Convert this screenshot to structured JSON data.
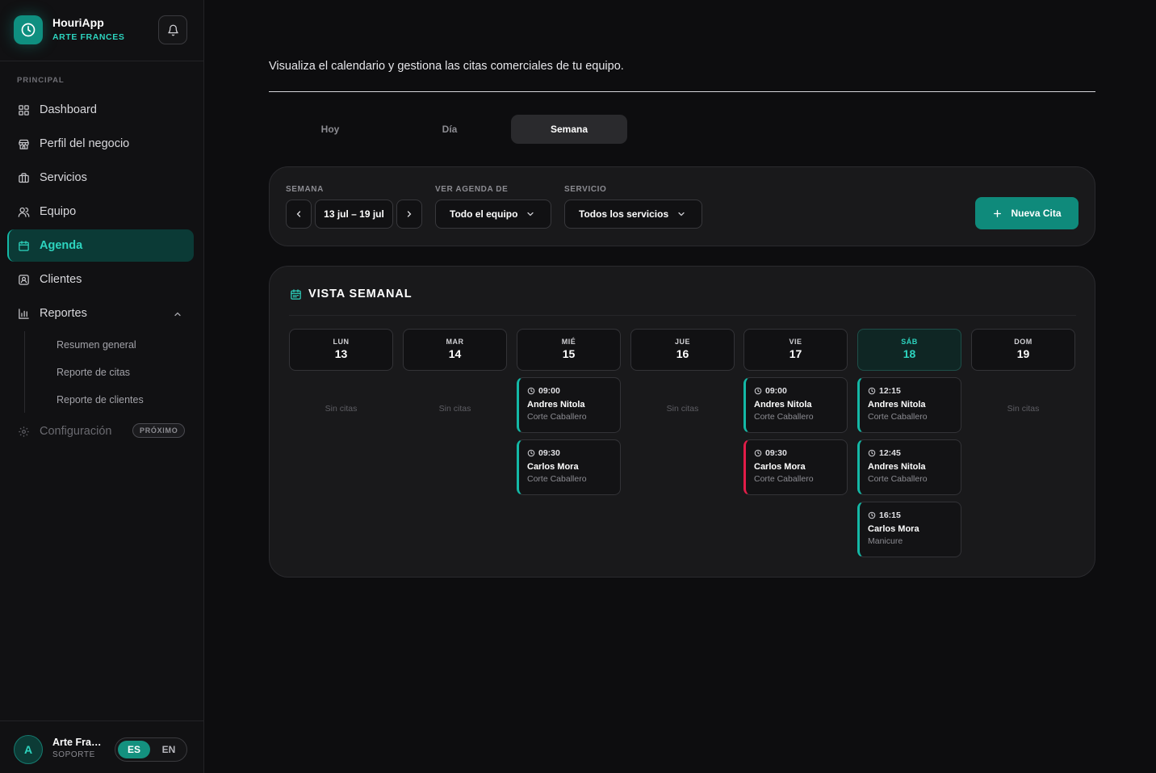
{
  "brand": {
    "name": "HouriApp",
    "subtitle": "ARTE FRANCES"
  },
  "sidebar": {
    "section_label": "PRINCIPAL",
    "items": [
      {
        "label": "Dashboard",
        "icon": "grid-icon"
      },
      {
        "label": "Perfil del negocio",
        "icon": "store-icon"
      },
      {
        "label": "Servicios",
        "icon": "briefcase-icon"
      },
      {
        "label": "Equipo",
        "icon": "users-icon"
      },
      {
        "label": "Agenda",
        "icon": "calendar-icon",
        "active": true
      },
      {
        "label": "Clientes",
        "icon": "contact-icon"
      },
      {
        "label": "Reportes",
        "icon": "bar-chart-icon",
        "expanded": true
      }
    ],
    "report_subitems": [
      "Resumen general",
      "Reporte de citas",
      "Reporte de clientes"
    ],
    "config": {
      "label": "Configuración",
      "badge": "PRÓXIMO",
      "icon": "gear-icon"
    }
  },
  "user": {
    "initial": "A",
    "name": "Arte Frances",
    "role": "SOPORTE"
  },
  "language": {
    "es": "ES",
    "en": "EN",
    "selected": "ES"
  },
  "page": {
    "subtitle": "Visualiza el calendario y gestiona las citas comerciales de tu equipo.",
    "view_tabs": [
      "Hoy",
      "Día",
      "Semana"
    ],
    "active_view": "Semana"
  },
  "filters": {
    "week_label": "SEMANA",
    "week_value": "13 jul – 19 jul",
    "agenda_label": "VER AGENDA DE",
    "agenda_value": "Todo el equipo",
    "service_label": "SERVICIO",
    "service_value": "Todos los servicios",
    "new_button": "Nueva Cita"
  },
  "calendar": {
    "title": "VISTA SEMANAL",
    "empty_text": "Sin citas",
    "days": [
      {
        "name": "LUN",
        "num": "13",
        "appointments": []
      },
      {
        "name": "MAR",
        "num": "14",
        "appointments": []
      },
      {
        "name": "MIÉ",
        "num": "15",
        "appointments": [
          {
            "time": "09:00",
            "client": "Andres Nitola",
            "service": "Corte Caballero",
            "color": "#14b8a6"
          },
          {
            "time": "09:30",
            "client": "Carlos Mora",
            "service": "Corte Caballero",
            "color": "#14b8a6"
          }
        ]
      },
      {
        "name": "JUE",
        "num": "16",
        "appointments": []
      },
      {
        "name": "VIE",
        "num": "17",
        "appointments": [
          {
            "time": "09:00",
            "client": "Andres Nitola",
            "service": "Corte Caballero",
            "color": "#14b8a6"
          },
          {
            "time": "09:30",
            "client": "Carlos Mora",
            "service": "Corte Caballero",
            "color": "#e11d48"
          }
        ]
      },
      {
        "name": "SÁB",
        "num": "18",
        "today": true,
        "appointments": [
          {
            "time": "12:15",
            "client": "Andres Nitola",
            "service": "Corte Caballero",
            "color": "#14b8a6"
          },
          {
            "time": "12:45",
            "client": "Andres Nitola",
            "service": "Corte Caballero",
            "color": "#14b8a6"
          },
          {
            "time": "16:15",
            "client": "Carlos Mora",
            "service": "Manicure",
            "color": "#14b8a6"
          }
        ]
      },
      {
        "name": "DOM",
        "num": "19",
        "appointments": []
      }
    ]
  },
  "colors": {
    "accent": "#14b8a6",
    "accent_text": "#2dd4bf",
    "alert": "#e11d48",
    "background": "#0d0d0f",
    "panel": "#19191b"
  }
}
